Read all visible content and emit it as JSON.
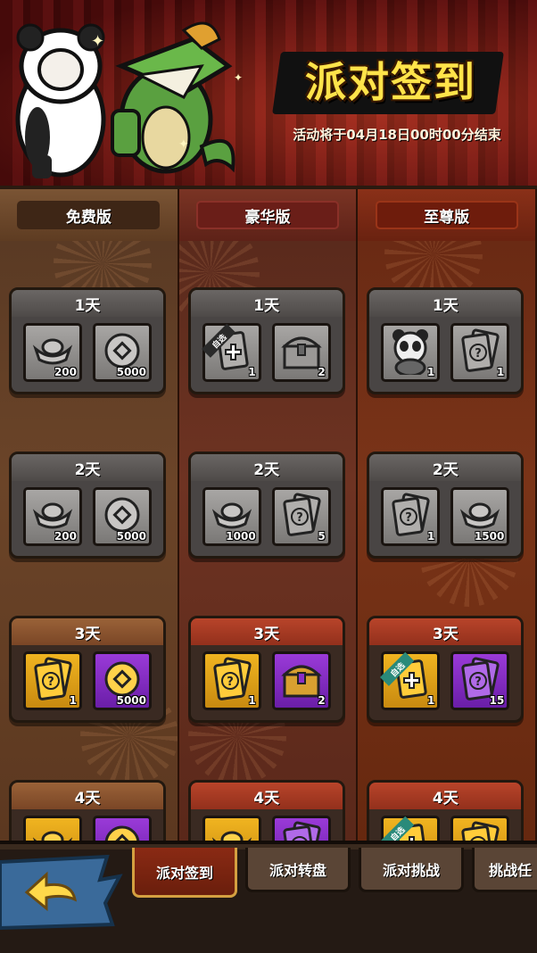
{
  "header": {
    "title": "派对签到",
    "subtitle": "活动将于04月18日00时00分结束"
  },
  "tiers": [
    {
      "label": "免费版"
    },
    {
      "label": "豪华版"
    },
    {
      "label": "至尊版"
    }
  ],
  "columns": [
    {
      "days": [
        {
          "label": "1天",
          "style": "gray",
          "rewards": [
            {
              "icon": "silver-ingot-icon",
              "bg": "gray",
              "qty": "200"
            },
            {
              "icon": "coin-icon",
              "bg": "gray",
              "qty": "5000"
            }
          ]
        },
        {
          "label": "2天",
          "style": "gray",
          "rewards": [
            {
              "icon": "silver-ingot-icon",
              "bg": "gray",
              "qty": "200"
            },
            {
              "icon": "coin-icon",
              "bg": "gray",
              "qty": "5000"
            }
          ]
        },
        {
          "label": "3天",
          "style": "warm",
          "rewards": [
            {
              "icon": "question-card-icon",
              "bg": "gold",
              "qty": "1"
            },
            {
              "icon": "gold-coin-icon",
              "bg": "purple",
              "qty": "5000"
            }
          ]
        },
        {
          "label": "4天",
          "style": "warm",
          "rewards": [
            {
              "icon": "gold-ingot-icon",
              "bg": "gold",
              "qty": ""
            },
            {
              "icon": "gold-coin-icon",
              "bg": "purple",
              "qty": ""
            }
          ]
        }
      ]
    },
    {
      "days": [
        {
          "label": "1天",
          "style": "gray",
          "rewards": [
            {
              "icon": "choice-card-icon",
              "bg": "gray",
              "qty": "1",
              "ribbon": "自选"
            },
            {
              "icon": "treasure-chest-icon",
              "bg": "gray",
              "qty": "2"
            }
          ]
        },
        {
          "label": "2天",
          "style": "gray",
          "rewards": [
            {
              "icon": "silver-ingot-icon",
              "bg": "gray",
              "qty": "1000"
            },
            {
              "icon": "question-card-icon",
              "bg": "gray",
              "qty": "5"
            }
          ]
        },
        {
          "label": "3天",
          "style": "red",
          "rewards": [
            {
              "icon": "question-card-icon",
              "bg": "gold",
              "qty": "1"
            },
            {
              "icon": "treasure-chest-icon",
              "bg": "purple",
              "qty": "2"
            }
          ]
        },
        {
          "label": "4天",
          "style": "red",
          "rewards": [
            {
              "icon": "gold-ingot-icon",
              "bg": "gold",
              "qty": ""
            },
            {
              "icon": "question-card-icon",
              "bg": "purple",
              "qty": ""
            }
          ]
        }
      ]
    },
    {
      "days": [
        {
          "label": "1天",
          "style": "gray",
          "rewards": [
            {
              "icon": "panda-character-icon",
              "bg": "gray",
              "qty": "1"
            },
            {
              "icon": "question-card-icon",
              "bg": "gray",
              "qty": "1"
            }
          ]
        },
        {
          "label": "2天",
          "style": "gray",
          "rewards": [
            {
              "icon": "question-card-icon",
              "bg": "gray",
              "qty": "1"
            },
            {
              "icon": "silver-ingot-icon",
              "bg": "gray",
              "qty": "1500"
            }
          ]
        },
        {
          "label": "3天",
          "style": "red",
          "rewards": [
            {
              "icon": "choice-card-icon",
              "bg": "gold",
              "qty": "1",
              "ribbon": "自选",
              "ribbon_color": "teal"
            },
            {
              "icon": "question-card-icon",
              "bg": "purple",
              "qty": "15"
            }
          ]
        },
        {
          "label": "4天",
          "style": "red",
          "rewards": [
            {
              "icon": "choice-card-icon",
              "bg": "gold",
              "qty": "",
              "ribbon": "自选",
              "ribbon_color": "teal"
            },
            {
              "icon": "question-card-icon",
              "bg": "gold",
              "qty": ""
            }
          ]
        }
      ]
    }
  ],
  "nav": {
    "tabs": [
      {
        "label": "派对签到",
        "active": true
      },
      {
        "label": "派对转盘",
        "active": false
      },
      {
        "label": "派对挑战",
        "active": false
      },
      {
        "label": "挑战任",
        "active": false
      }
    ]
  },
  "colors": {
    "title": "#ffe34a",
    "curtain": "#7a1414",
    "gold_slot": "#f0b420",
    "purple_slot": "#8a2ec8"
  }
}
